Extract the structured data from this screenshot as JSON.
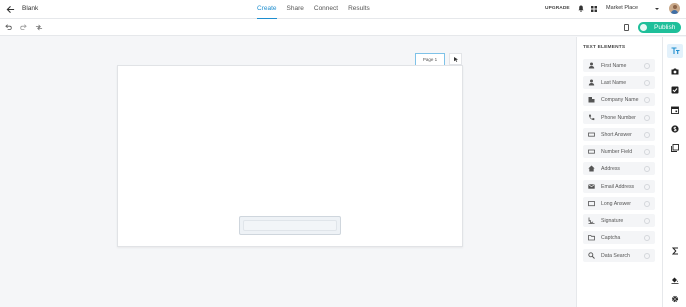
{
  "header": {
    "title": "Blank",
    "tabs": [
      {
        "label": "Create",
        "active": true
      },
      {
        "label": "Share",
        "active": false
      },
      {
        "label": "Connect",
        "active": false
      },
      {
        "label": "Results",
        "active": false
      }
    ],
    "upgrade_label": "UPGRADE",
    "workspace": "Market Place"
  },
  "toolbar": {
    "publish_label": "Publish"
  },
  "canvas": {
    "page_tab_label": "Page 1"
  },
  "panel": {
    "title": "TEXT ELEMENTS",
    "items": [
      {
        "label": "First Name",
        "icon": "person-icon"
      },
      {
        "label": "Last Name",
        "icon": "person-icon"
      },
      {
        "label": "Company Name",
        "icon": "building-icon"
      },
      {
        "label": "Phone Number",
        "icon": "phone-icon"
      },
      {
        "label": "Short Answer",
        "icon": "short-answer-icon"
      },
      {
        "label": "Number Field",
        "icon": "number-field-icon"
      },
      {
        "label": "Address",
        "icon": "home-icon"
      },
      {
        "label": "Email Address",
        "icon": "email-icon"
      },
      {
        "label": "Long Answer",
        "icon": "long-answer-icon"
      },
      {
        "label": "Signature",
        "icon": "signature-icon"
      },
      {
        "label": "Captcha",
        "icon": "folder-icon"
      },
      {
        "label": "Data Search",
        "icon": "search-icon"
      }
    ]
  },
  "colors": {
    "accent": "#1e8ecf",
    "publish": "#1fbf9a"
  }
}
